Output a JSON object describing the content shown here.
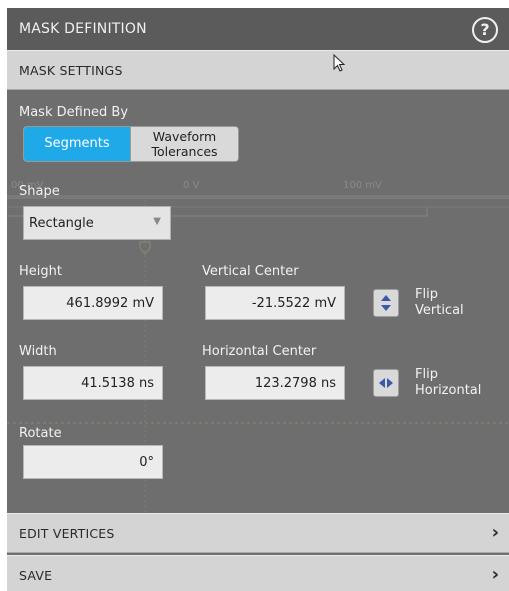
{
  "header": {
    "title": "MASK DEFINITION",
    "help_icon": "help-circle-icon"
  },
  "sections": {
    "mask_settings": "MASK SETTINGS",
    "edit_vertices": "EDIT VERTICES",
    "save": "SAVE"
  },
  "mask_defined_by": {
    "label": "Mask Defined By",
    "options": [
      "Segments",
      "Waveform Tolerances"
    ],
    "option_segments": "Segments",
    "option_waveform_line1": "Waveform",
    "option_waveform_line2": "Tolerances",
    "selected": "Segments"
  },
  "shape": {
    "label": "Shape",
    "value": "Rectangle"
  },
  "height": {
    "label": "Height",
    "value": "461.8992 mV"
  },
  "vertical_center": {
    "label": "Vertical Center",
    "value": "-21.5522 mV"
  },
  "flip_vertical": {
    "line1": "Flip",
    "line2": "Vertical"
  },
  "width": {
    "label": "Width",
    "value": "41.5138 ns"
  },
  "horizontal_center": {
    "label": "Horizontal Center",
    "value": "123.2798 ns"
  },
  "flip_horizontal": {
    "line1": "Flip",
    "line2": "Horizontal"
  },
  "rotate": {
    "label": "Rotate",
    "value": "0°"
  },
  "background_axis": {
    "left": "00 mV",
    "mid": "0 V",
    "right": "100 mV"
  },
  "colors": {
    "accent": "#1fa9e8",
    "panel": "#6e6e6e",
    "section_bar": "#d4d4d4"
  }
}
